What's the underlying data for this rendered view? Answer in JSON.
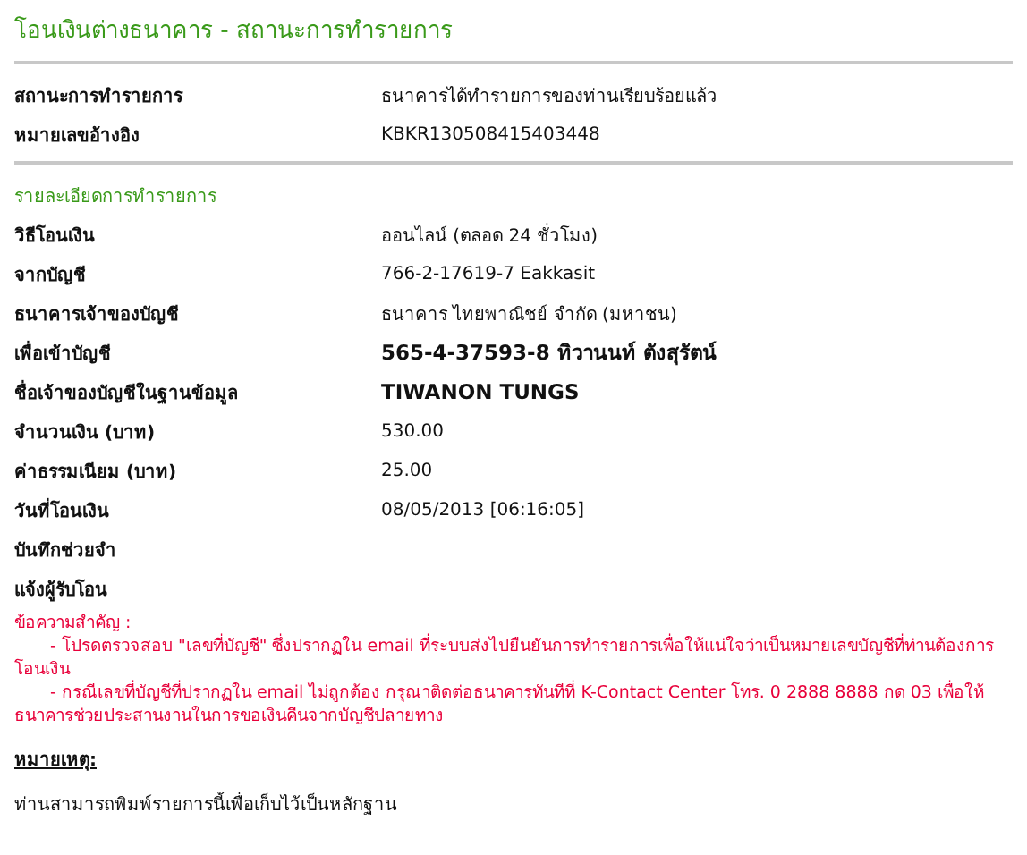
{
  "title": "โอนเงินต่างธนาคาร - สถานะการทำรายการ",
  "status_rows": [
    {
      "label": "สถานะการทำรายการ",
      "value": "ธนาคารได้ทำรายการของท่านเรียบร้อยแล้ว"
    },
    {
      "label": "หมายเลขอ้างอิง",
      "value": "KBKR130508415403448"
    }
  ],
  "details": {
    "heading": "รายละเอียดการทำรายการ",
    "rows": [
      {
        "label": "วิธีโอนเงิน",
        "value": "ออนไลน์ (ตลอด 24 ชั่วโมง)",
        "kind": "plain"
      },
      {
        "label": "จากบัญชี",
        "value": "766-2-17619-7 Eakkasit",
        "kind": "plain"
      },
      {
        "label": "ธนาคารเจ้าของบัญชี",
        "value": "ธนาคาร ไทยพาณิชย์ จำกัด (มหาชน)",
        "kind": "plain"
      },
      {
        "label": "เพื่อเข้าบัญชี",
        "value": "565-4-37593-8 ทิวานนท์ ตังสุรัตน์",
        "kind": "bold"
      },
      {
        "label": "ชื่อเจ้าของบัญชีในฐานข้อมูล",
        "value": "TIWANON TUNGS",
        "kind": "bold"
      },
      {
        "label": "จำนวนเงิน (บาท)",
        "value": "530.00",
        "kind": "plain"
      },
      {
        "label": "ค่าธรรมเนียม (บาท)",
        "value": "25.00",
        "kind": "plain"
      },
      {
        "label": "วันที่โอนเงิน",
        "value": "08/05/2013 [06:16:05]",
        "kind": "plain"
      }
    ]
  },
  "memo_label": "บันทึกช่วยจำ",
  "notify_label": "แจ้งผู้รับโอน",
  "important": {
    "heading": "ข้อความสำคัญ :",
    "items": [
      "- โปรดตรวจสอบ \"เลขที่บัญชี\" ซึ่งปรากฏใน email ที่ระบบส่งไปยืนยันการทำรายการเพื่อให้แน่ใจว่าเป็นหมายเลขบัญชีที่ท่านต้องการโอนเงิน",
      "- กรณีเลขที่บัญชีที่ปรากฏใน email ไม่ถูกต้อง กรุณาติดต่อธนาคารทันทีที่ K-Contact Center โทร. 0 2888 8888 กด 03 เพื่อให้ธนาคารช่วยประสานงานในการขอเงินคืนจากบัญชีปลายทาง"
    ]
  },
  "note": {
    "heading": "หมายเหตุ:",
    "text": "ท่านสามารถพิมพ์รายการนี้เพื่อเก็บไว้เป็นหลักฐาน"
  }
}
